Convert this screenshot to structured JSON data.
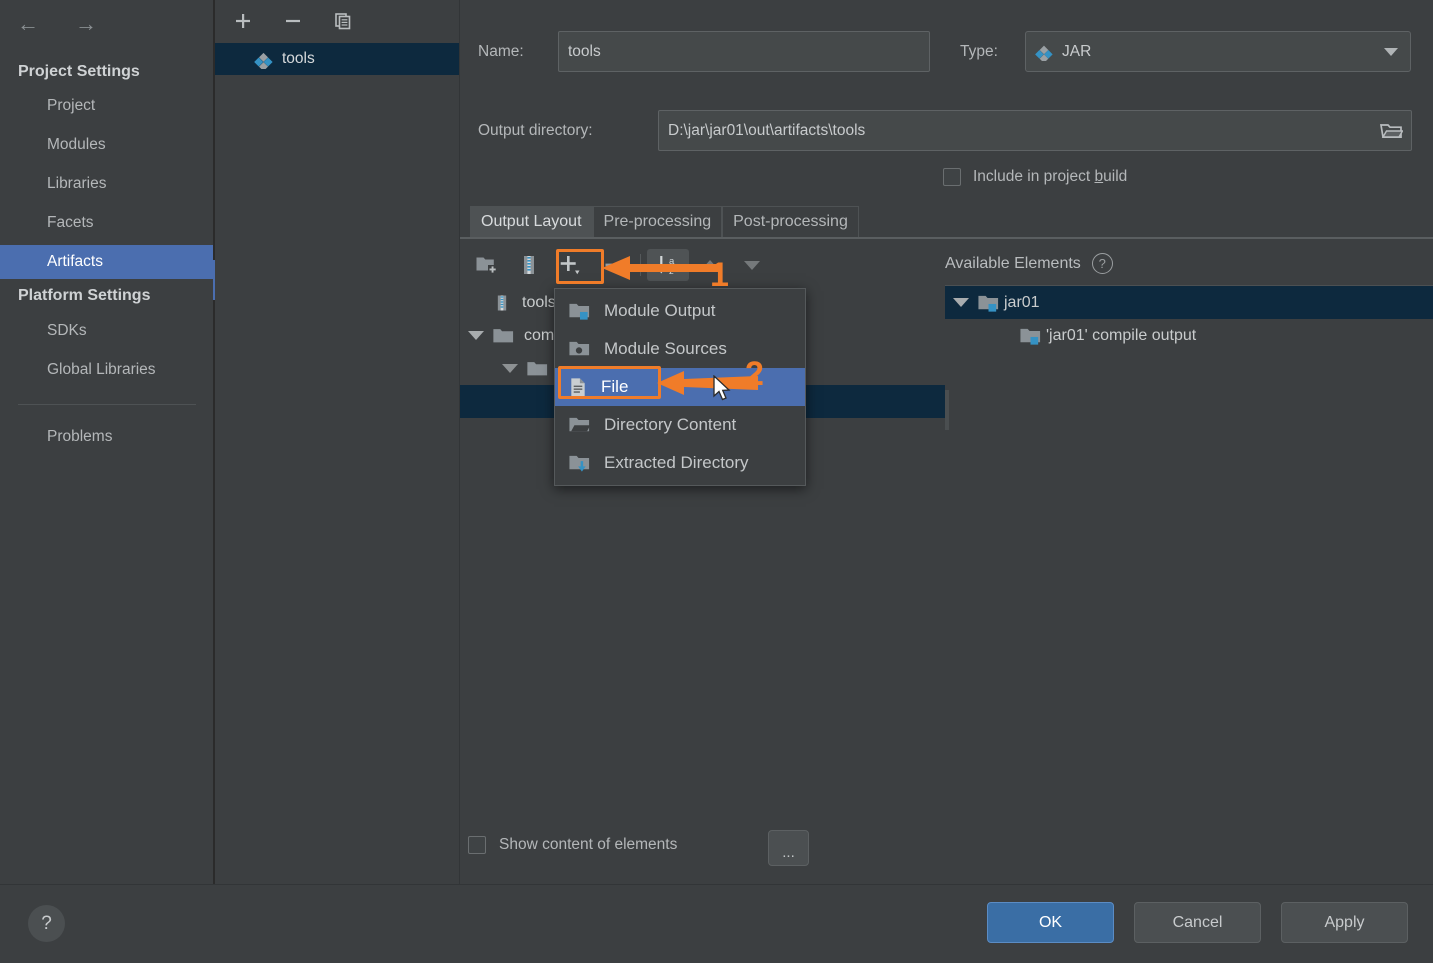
{
  "sidebar": {
    "nav": {
      "back": "←",
      "forward": "→"
    },
    "groups": [
      {
        "label": "Project Settings"
      },
      {
        "label": "Platform Settings"
      }
    ],
    "project_settings_items": [
      {
        "label": "Project"
      },
      {
        "label": "Modules"
      },
      {
        "label": "Libraries"
      },
      {
        "label": "Facets"
      },
      {
        "label": "Artifacts"
      }
    ],
    "platform_settings_items": [
      {
        "label": "SDKs"
      },
      {
        "label": "Global Libraries"
      }
    ],
    "problems_label": "Problems",
    "selected_item": "Artifacts"
  },
  "artifacts_panel": {
    "toolbar": [
      {
        "name": "add-artifact",
        "glyph": "+"
      },
      {
        "name": "remove-artifact",
        "glyph": "−"
      },
      {
        "name": "copy-artifact",
        "glyph": "copy"
      }
    ],
    "items": [
      {
        "label": "tools",
        "icon": "jar-artifact-icon",
        "selected": true
      }
    ]
  },
  "editor": {
    "name_label": "Name:",
    "name_value": "tools",
    "type_label": "Type:",
    "type_value": "JAR",
    "output_dir_label": "Output directory:",
    "output_dir_value": "D:\\jar\\jar01\\out\\artifacts\\tools",
    "include_build_label_pre": "Include in project ",
    "include_build_label_accel": "b",
    "include_build_label_post": "uild",
    "include_build_checked": false,
    "tabs": [
      {
        "label": "Output Layout",
        "active": true
      },
      {
        "label": "Pre-processing",
        "active": false
      },
      {
        "label": "Post-processing",
        "active": false
      }
    ],
    "layout_toolbar": [
      {
        "name": "create-directory-icon",
        "title": "Create Directory"
      },
      {
        "name": "create-archive-icon",
        "title": "Create Archive"
      },
      {
        "name": "add-copy-of-icon",
        "title": "Add Copy of"
      },
      {
        "name": "remove-icon",
        "title": "Remove"
      },
      {
        "name": "sort-alphabetically-icon",
        "title": "Sort",
        "pressed": true
      },
      {
        "name": "move-up-icon",
        "title": "Move Up"
      },
      {
        "name": "move-down-icon",
        "title": "Move Down"
      }
    ],
    "output_tree": [
      {
        "label": "tools.jar",
        "icon": "archive-icon",
        "depth": 0,
        "twisty": "none"
      },
      {
        "label": "com",
        "icon": "folder-icon",
        "depth": 0,
        "twisty": "open"
      },
      {
        "label": "",
        "icon": "folder-icon",
        "depth": 1,
        "twisty": "open"
      },
      {
        "label": "",
        "icon": "",
        "depth": 2,
        "twisty": "none",
        "selected": true
      }
    ],
    "available_elements_label": "Available Elements",
    "available_tree": [
      {
        "label": "jar01",
        "icon": "module-folder-icon",
        "depth": 0,
        "twisty": "open",
        "selected": true
      },
      {
        "label": "'jar01' compile output",
        "icon": "module-folder-icon",
        "depth": 1,
        "twisty": "none"
      }
    ],
    "show_content_label": "Show content of elements",
    "show_content_checked": false,
    "dots_button_label": "..."
  },
  "menu": {
    "items": [
      {
        "label": "Module Output",
        "icon": "module-output-icon",
        "highlighted": false
      },
      {
        "label": "Module Sources",
        "icon": "module-sources-icon",
        "highlighted": false
      },
      {
        "label": "File",
        "icon": "file-icon",
        "highlighted": true
      },
      {
        "label": "Directory Content",
        "icon": "directory-content-icon",
        "highlighted": false
      },
      {
        "label": "Extracted Directory",
        "icon": "extracted-directory-icon",
        "highlighted": false
      }
    ]
  },
  "annotations": {
    "accent_color": "#f07c29",
    "markers": [
      {
        "label": "1",
        "target": "add-copy-of-toolbar-button"
      },
      {
        "label": "2",
        "target": "menu-item-file"
      }
    ]
  },
  "footer": {
    "help_label": "?",
    "buttons": [
      {
        "label": "OK",
        "primary": true
      },
      {
        "label": "Cancel",
        "primary": false
      },
      {
        "label": "Apply",
        "primary": false
      }
    ]
  },
  "colors": {
    "background": "#3c3f41",
    "selection_blue": "#4b6eaf",
    "tree_selection": "#0d293e",
    "accent_orange": "#f07c29",
    "icon_blue": "#3592c4"
  }
}
